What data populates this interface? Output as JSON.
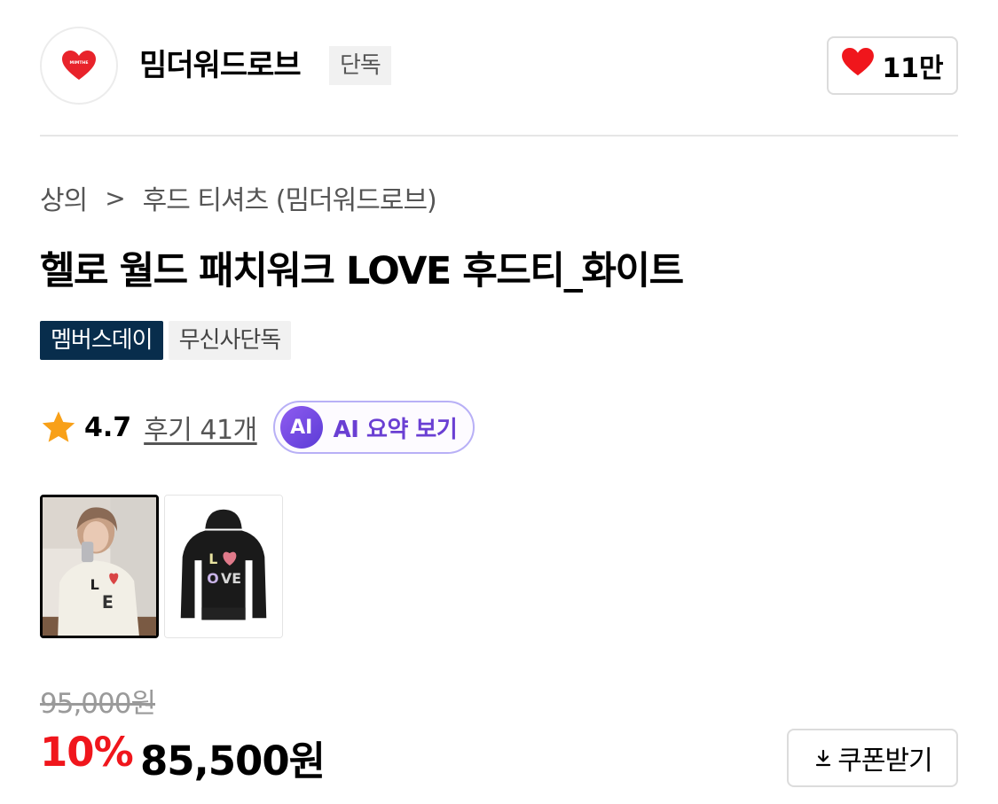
{
  "brand": {
    "name": "밈더워드로브",
    "tag": "단독",
    "logo_text": "MIMTHE",
    "logo_icon": "heart-logo"
  },
  "like": {
    "count": "11만",
    "icon": "heart-icon",
    "color": "#f0161c"
  },
  "breadcrumb": {
    "category": "상의",
    "subcategory": "후드 티셔츠 (밈더워드로브)"
  },
  "product": {
    "title": "헬로 월드 패치워크 LOVE 후드티_화이트"
  },
  "badges": {
    "member": "멤버스데이",
    "exclusive": "무신사단독"
  },
  "rating": {
    "value": "4.7",
    "reviews": "후기 41개",
    "ai_badge": "AI",
    "ai_label": "AI 요약 보기"
  },
  "thumbnails": [
    {
      "subject": "model wearing white LOVE hoodie"
    },
    {
      "subject": "black LOVE hoodie product shot"
    }
  ],
  "price": {
    "original": "95,000원",
    "discount": "10%",
    "sale": "85,500원"
  },
  "coupon": {
    "label": "쿠폰받기",
    "icon": "download-icon"
  },
  "colors": {
    "accent_red": "#f0161c",
    "member_badge": "#082d4c",
    "ai_purple": "#6a3fd3"
  }
}
